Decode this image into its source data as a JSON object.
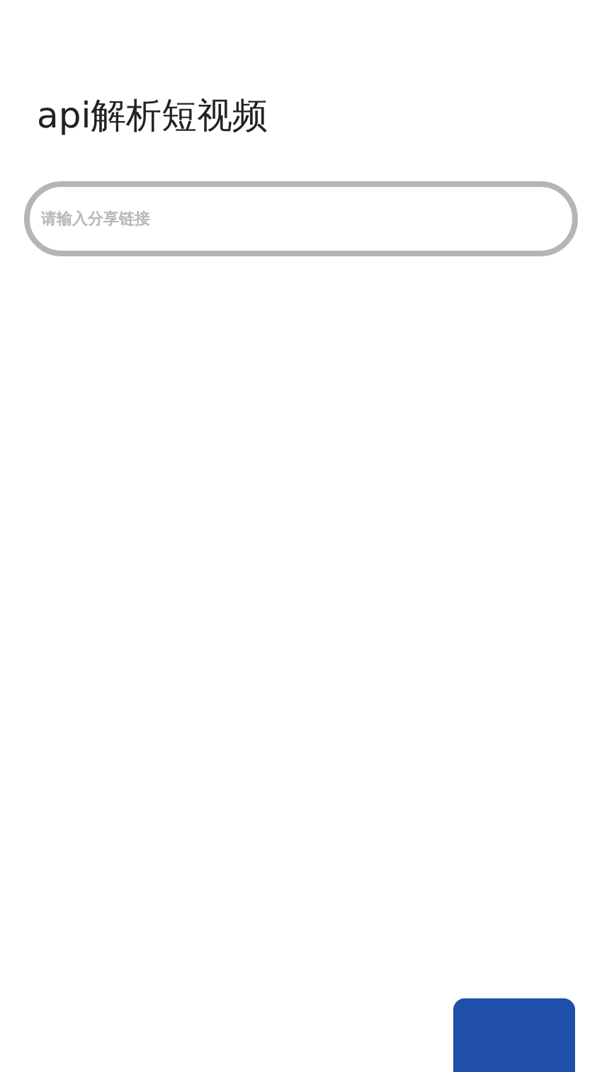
{
  "title": "api解析短视频",
  "link_field": {
    "placeholder": "请输入分享链接"
  }
}
